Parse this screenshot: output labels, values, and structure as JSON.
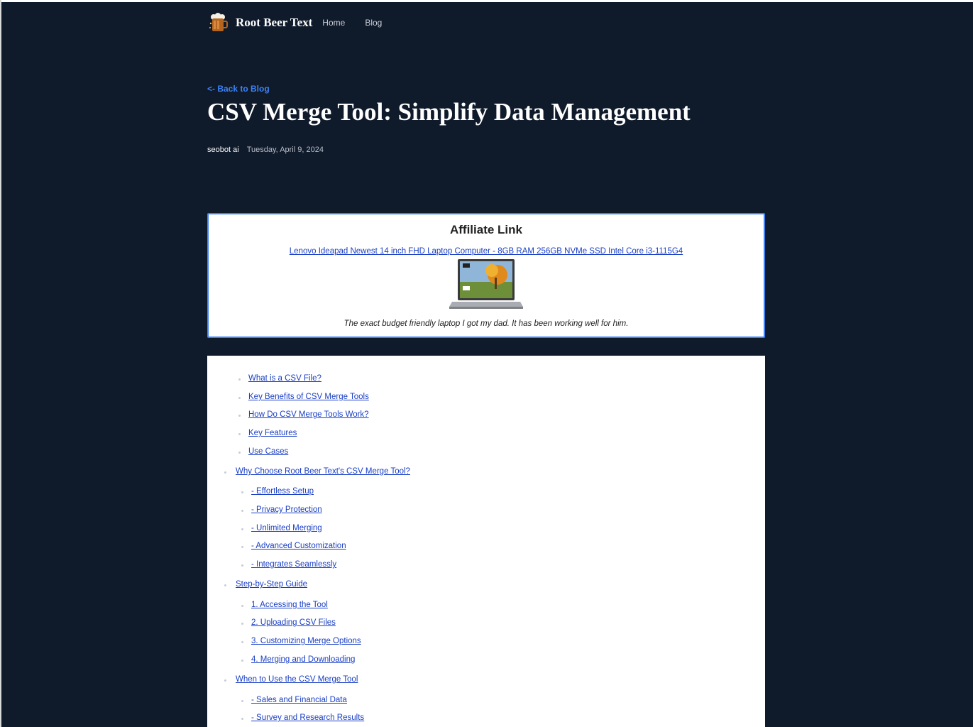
{
  "nav": {
    "brand": "Root Beer Text",
    "links": [
      "Home",
      "Blog"
    ]
  },
  "back_link": "<- Back to Blog",
  "post": {
    "title": "CSV Merge Tool: Simplify Data Management",
    "author": "seobot ai",
    "date": "Tuesday, April 9, 2024"
  },
  "affiliate": {
    "heading": "Affiliate Link",
    "link_text": "Lenovo Ideapad Newest 14 inch FHD Laptop Computer - 8GB RAM 256GB NVMe SSD Intel Core i3-1115G4",
    "image_icon": "laptop-image",
    "caption": "The exact budget friendly laptop I got my dad. It has been working well for him."
  },
  "toc": {
    "items": [
      "What is a CSV File?",
      "Key Benefits of CSV Merge Tools",
      "How Do CSV Merge Tools Work?",
      "Key Features",
      "Use Cases",
      "Why Choose Root Beer Text's CSV Merge Tool?",
      "- Effortless Setup",
      "- Privacy Protection",
      "- Unlimited Merging",
      "- Advanced Customization",
      "- Integrates Seamlessly",
      "Step-by-Step Guide",
      "1. Accessing the Tool",
      "2. Uploading CSV Files",
      "3. Customizing Merge Options",
      "4. Merging and Downloading",
      "When to Use the CSV Merge Tool",
      "- Sales and Financial Data",
      "- Survey and Research Results"
    ]
  },
  "colors": {
    "page_background": "#0f1a2b",
    "accent": "#3b82f6",
    "link": "#1a3fc4"
  }
}
